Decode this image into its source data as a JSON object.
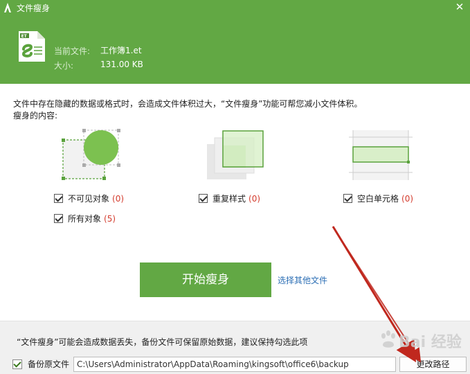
{
  "window": {
    "title": "文件瘦身",
    "close_glyph": "✕"
  },
  "file": {
    "icon_badge": "ET",
    "current_label": "当前文件:",
    "current_value": "工作簿1.et",
    "size_label": "大小:",
    "size_value": "131.00 KB"
  },
  "description": "文件中存在隐藏的数据或格式时，会造成文件体积过大，“文件瘦身”功能可帮您减小文件体积。",
  "content_label": "瘦身的内容:",
  "options": [
    {
      "label": "不可见对象",
      "count": "(0)",
      "checked": true
    },
    {
      "label": "重复样式",
      "count": "(0)",
      "checked": true
    },
    {
      "label": "空白单元格",
      "count": "(0)",
      "checked": true
    },
    {
      "label": "所有对象",
      "count": "(5)",
      "checked": true
    }
  ],
  "start_button": "开始瘦身",
  "other_file_link": "选择其他文件",
  "footer": {
    "warning": "“文件瘦身”可能会造成数据丢失，备份文件可保留原始数据，建议保持勾选此项",
    "backup_label": "备份原文件",
    "backup_path": "C:\\Users\\Administrator\\AppData\\Roaming\\kingsoft\\office6\\backup",
    "change_path_button": "更改路径"
  },
  "watermark": "Bai 经验",
  "colors": {
    "brand_green": "#62a844",
    "link_blue": "#2d6fb5",
    "count_red": "#d43c2e",
    "annotation_red": "#c0281e"
  }
}
